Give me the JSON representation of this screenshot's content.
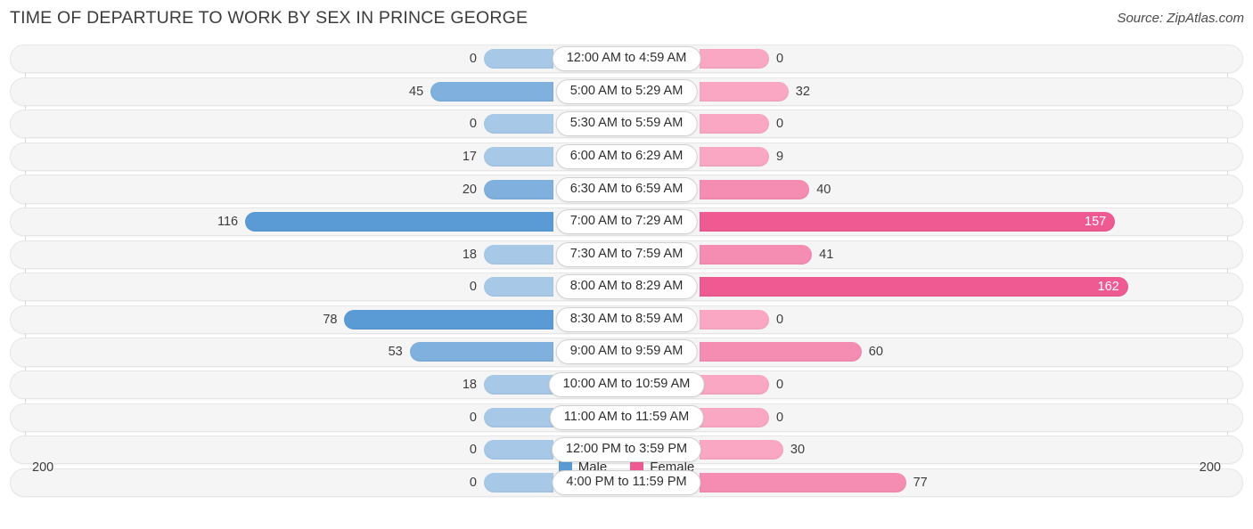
{
  "header": {
    "title": "TIME OF DEPARTURE TO WORK BY SEX IN PRINCE GEORGE",
    "source": "Source: ZipAtlas.com"
  },
  "axis": {
    "left_max_label": "200",
    "right_max_label": "200"
  },
  "legend": [
    {
      "label": "Male",
      "color": "#5b9bd5"
    },
    {
      "label": "Female",
      "color": "#ef5a93"
    }
  ],
  "colors": {
    "male_light": "#a8c8e8",
    "male_mid": "#7fb0de",
    "male_strong": "#5b9bd5",
    "female_light": "#f9a7c3",
    "female_mid": "#f58cb2",
    "female_strong": "#ef5a93",
    "track": "#f5f5f5",
    "gridline": "#d8d8d8"
  },
  "chart_data": {
    "type": "bar",
    "title": "TIME OF DEPARTURE TO WORK BY SEX IN PRINCE GEORGE",
    "subtitle": "",
    "xlabel": "",
    "ylabel": "",
    "orientation": "horizontal-diverging",
    "axis_max": 200,
    "xlim": [
      200,
      0,
      200
    ],
    "grid": true,
    "legend_position": "bottom-center",
    "categories": [
      "12:00 AM to 4:59 AM",
      "5:00 AM to 5:29 AM",
      "5:30 AM to 5:59 AM",
      "6:00 AM to 6:29 AM",
      "6:30 AM to 6:59 AM",
      "7:00 AM to 7:29 AM",
      "7:30 AM to 7:59 AM",
      "8:00 AM to 8:29 AM",
      "8:30 AM to 8:59 AM",
      "9:00 AM to 9:59 AM",
      "10:00 AM to 10:59 AM",
      "11:00 AM to 11:59 AM",
      "12:00 PM to 3:59 PM",
      "4:00 PM to 11:59 PM"
    ],
    "series": [
      {
        "name": "Male",
        "color": "#5b9bd5",
        "values": [
          0,
          45,
          0,
          17,
          20,
          116,
          18,
          0,
          78,
          53,
          18,
          0,
          0,
          0
        ]
      },
      {
        "name": "Female",
        "color": "#ef5a93",
        "values": [
          0,
          32,
          0,
          9,
          40,
          157,
          41,
          162,
          0,
          60,
          0,
          0,
          30,
          77
        ]
      }
    ]
  }
}
